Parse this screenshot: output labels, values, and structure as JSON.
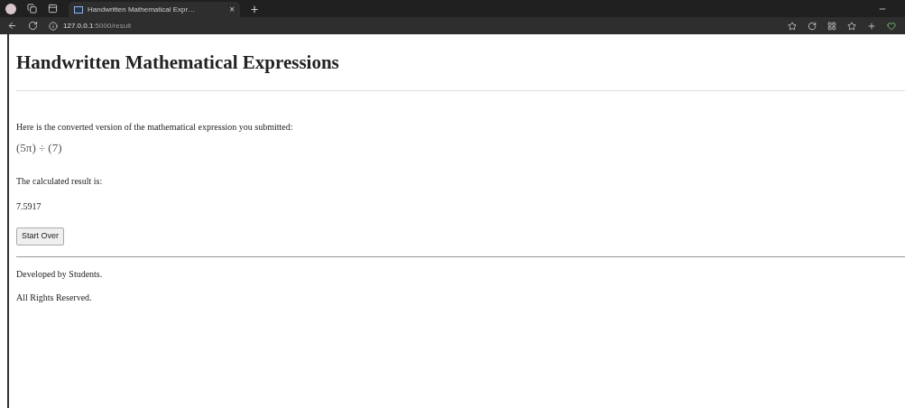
{
  "browser": {
    "tab_title": "Handwritten Mathematical Expr…",
    "new_tab": "+",
    "close": "×",
    "url_host": "127.0.0.1",
    "url_path": ":5000/result"
  },
  "page": {
    "heading": "Handwritten Mathematical Expressions",
    "intro": "Here is the converted version of the mathematical expression you submitted:",
    "expression": "(5π) ÷ (7)",
    "result_label": "The calculated result is:",
    "result": "7.5917",
    "button": "Start Over",
    "footer": [
      "Developed by Students.",
      "All Rights Reserved."
    ]
  }
}
